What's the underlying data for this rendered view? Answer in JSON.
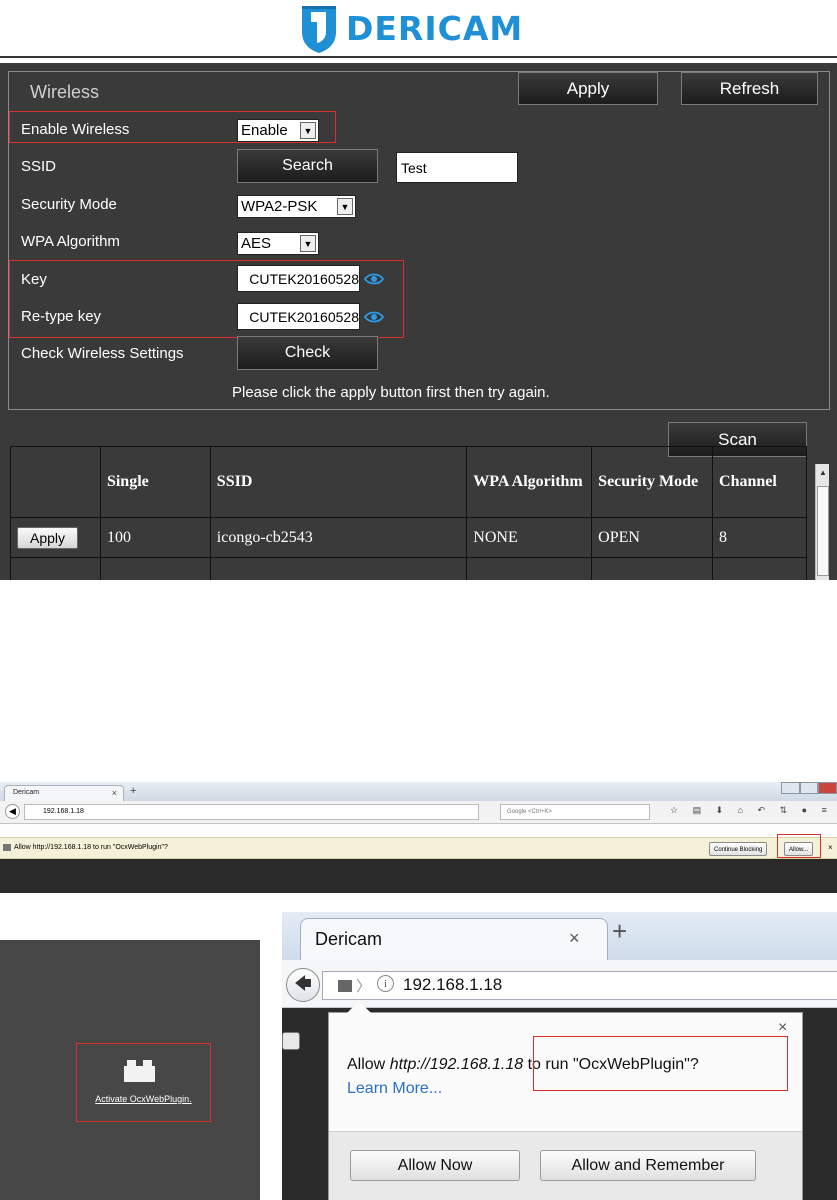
{
  "brand": {
    "name": "DERICAM",
    "color": "#1f8fd6"
  },
  "wireless": {
    "title": "Wireless",
    "apply_label": "Apply",
    "refresh_label": "Refresh",
    "enable_label": "Enable Wireless",
    "enable_value": "Enable",
    "ssid_label": "SSID",
    "search_label": "Search",
    "ssid_value": "Test",
    "security_label": "Security Mode",
    "security_value": "WPA2-PSK",
    "wpa_label": "WPA Algorithm",
    "wpa_value": "AES",
    "key_label": "Key",
    "key_value": "CUTEK20160528",
    "retype_label": "Re-type key",
    "retype_value": "CUTEK20160528",
    "check_label": "Check Wireless Settings",
    "check_button": "Check",
    "message": "Please click the apply button first then try again.",
    "scan_label": "Scan"
  },
  "scan_table": {
    "headers": [
      "",
      "Single",
      "SSID",
      "WPA Algorithm",
      "Security Mode",
      "Channel"
    ],
    "rows": [
      {
        "action": "Apply",
        "single": "100",
        "ssid": "icongo-cb2543",
        "wpa": "NONE",
        "security": "OPEN",
        "channel": "8"
      }
    ]
  },
  "browser_bar": {
    "tab_title": "Dericam",
    "tab_close": "×",
    "new_tab": "+",
    "url": "192.168.1.18",
    "search_placeholder": "Google <Ctrl+K>",
    "notification": "Allow http://192.168.1.18 to run \"OcxWebPlugin\"?",
    "continue_label": "Continue Blocking",
    "allow_label": "Allow..."
  },
  "plugin_panel": {
    "link": "Activate OcxWebPlugin."
  },
  "firefox_popup": {
    "tab_title": "Dericam",
    "tab_close": "×",
    "new_tab": "+",
    "url": "192.168.1.18",
    "info": "i",
    "close": "×",
    "msg_prefix": "Allow ",
    "msg_url": "http://192.168.1.18",
    "msg_suffix": " to run \"OcxWebPlugin\"?",
    "learn_more": "Learn More...",
    "allow_now": "Allow Now",
    "allow_remember": "Allow and Remember"
  }
}
